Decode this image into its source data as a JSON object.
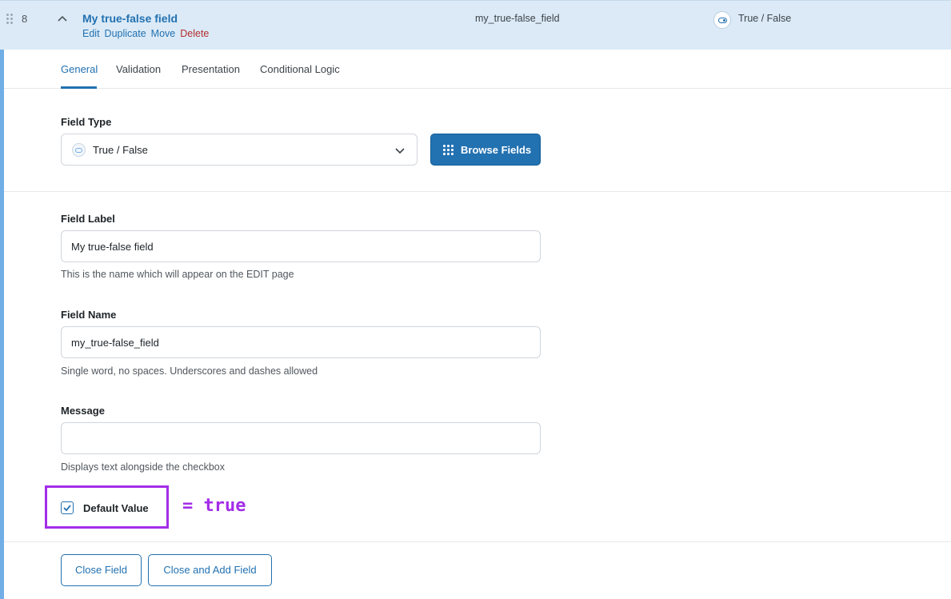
{
  "header": {
    "order": "8",
    "field_title": "My true-false field",
    "actions": [
      "Edit",
      "Duplicate",
      "Move",
      "Delete"
    ],
    "field_name": "my_true-false_field",
    "field_type": "True / False"
  },
  "tabs": [
    "General",
    "Validation",
    "Presentation",
    "Conditional Logic"
  ],
  "active_tab": "General",
  "field_type": {
    "label": "Field Type",
    "value": "True / False",
    "browse_label": "Browse Fields"
  },
  "field_label": {
    "label": "Field Label",
    "value": "My true-false field",
    "hint": "This is the name which will appear on the EDIT page"
  },
  "field_name": {
    "label": "Field Name",
    "value": "my_true-false_field",
    "hint": "Single word, no spaces. Underscores and dashes allowed"
  },
  "message": {
    "label": "Message",
    "value": "",
    "hint": "Displays text alongside the checkbox"
  },
  "default_value": {
    "label": "Default Value",
    "checked": true,
    "annotation": "= true"
  },
  "footer": {
    "close_label": "Close Field",
    "close_add_label": "Close and Add Field"
  },
  "colors": {
    "accent": "#2271b1",
    "header_bg": "#dbeaf6",
    "annotation": "#a32de8",
    "delete": "#b32d2e"
  }
}
